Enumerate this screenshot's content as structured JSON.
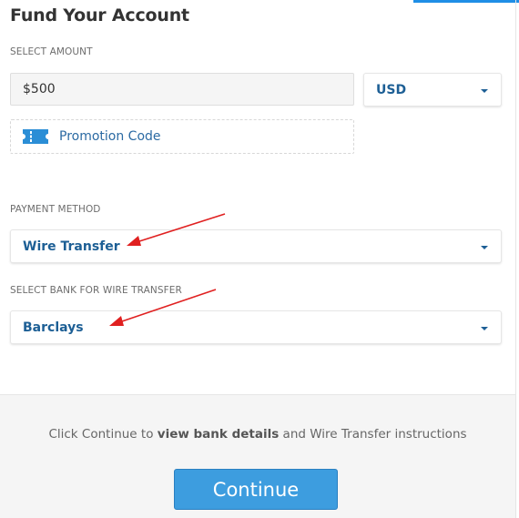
{
  "header": {
    "title": "Fund Your Account"
  },
  "amount": {
    "section_label": "SELECT AMOUNT",
    "value": "$500",
    "currency": "USD"
  },
  "promo": {
    "label": "Promotion Code",
    "icon": "ticket-icon"
  },
  "payment": {
    "section_label": "PAYMENT METHOD",
    "selected": "Wire Transfer"
  },
  "bank": {
    "section_label": "SELECT BANK FOR WIRE TRANSFER",
    "selected": "Barclays"
  },
  "footer": {
    "instruction_prefix": "Click Continue to ",
    "instruction_bold": "view bank details",
    "instruction_suffix": " and Wire Transfer instructions",
    "continue_label": "Continue"
  },
  "colors": {
    "accent": "#1f8ee6",
    "select_text": "#1d5f95",
    "button": "#3d9ddf",
    "annotation_arrow": "#e02020"
  }
}
